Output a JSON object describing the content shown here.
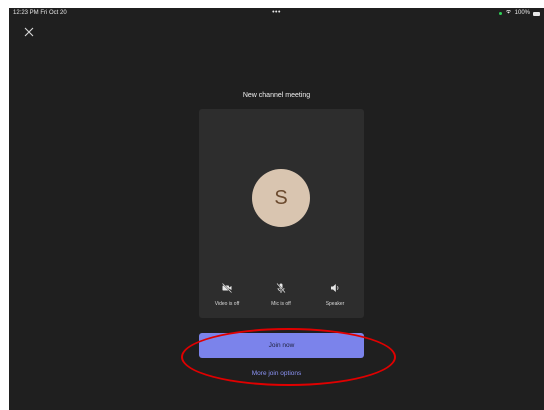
{
  "status_bar": {
    "time": "12:23 PM  Fri Oct 20",
    "center": "•••",
    "battery": "100%"
  },
  "meeting": {
    "title": "New channel meeting",
    "avatar_initial": "S"
  },
  "controls": {
    "video_label": "Video is off",
    "mic_label": "Mic is off",
    "speaker_label": "Speaker"
  },
  "actions": {
    "join_label": "Join now",
    "more_options_label": "More join options"
  },
  "colors": {
    "background": "#1f1f1f",
    "card": "#2d2d2d",
    "accent": "#7b83eb",
    "link": "#8b93f5",
    "avatar_bg": "#d9c5b0",
    "annotation": "#e00000"
  },
  "icons": {
    "close": "close-icon",
    "video": "video-off-icon",
    "mic": "mic-off-icon",
    "speaker": "speaker-icon"
  }
}
